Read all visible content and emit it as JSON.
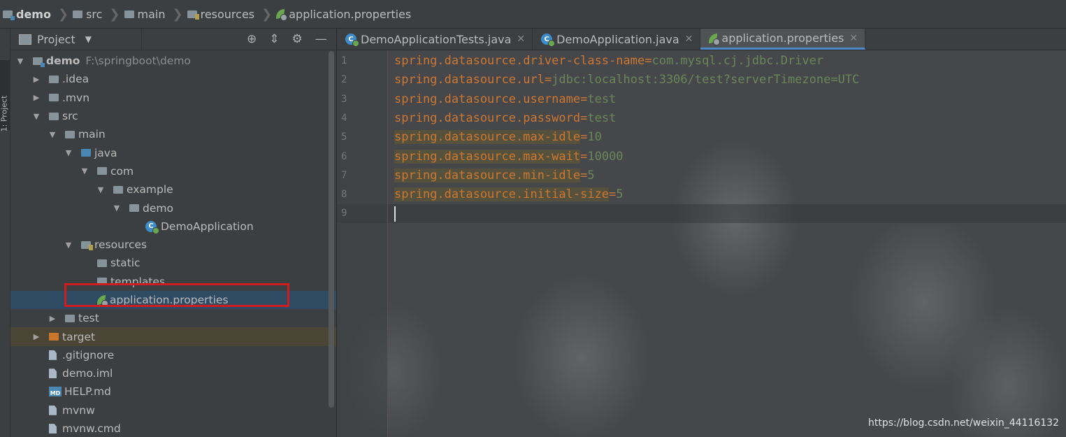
{
  "breadcrumb": {
    "items": [
      "demo",
      "src",
      "main",
      "resources",
      "application.properties"
    ]
  },
  "stripe": {
    "label": "1: Project"
  },
  "project_panel": {
    "title": "Project",
    "tools": [
      "locate-icon",
      "collapse-icon",
      "gear-icon",
      "minimize-icon"
    ],
    "tree": [
      {
        "label": "demo",
        "path": "F:\\springboot\\demo",
        "depth": 0,
        "arrow": "down",
        "icon": "module-folder-icon",
        "bold": true
      },
      {
        "label": ".idea",
        "depth": 1,
        "arrow": "right",
        "icon": "folder-icon"
      },
      {
        "label": ".mvn",
        "depth": 1,
        "arrow": "right",
        "icon": "folder-icon"
      },
      {
        "label": "src",
        "depth": 1,
        "arrow": "down",
        "icon": "folder-icon"
      },
      {
        "label": "main",
        "depth": 2,
        "arrow": "down",
        "icon": "folder-icon"
      },
      {
        "label": "java",
        "depth": 3,
        "arrow": "down",
        "icon": "source-folder-icon"
      },
      {
        "label": "com",
        "depth": 4,
        "arrow": "down",
        "icon": "package-icon"
      },
      {
        "label": "example",
        "depth": 5,
        "arrow": "down",
        "icon": "package-icon"
      },
      {
        "label": "demo",
        "depth": 6,
        "arrow": "down",
        "icon": "package-icon"
      },
      {
        "label": "DemoApplication",
        "depth": 7,
        "arrow": "",
        "icon": "spring-class-icon"
      },
      {
        "label": "resources",
        "depth": 3,
        "arrow": "down",
        "icon": "resources-folder-icon"
      },
      {
        "label": "static",
        "depth": 4,
        "arrow": "",
        "icon": "package-icon"
      },
      {
        "label": "templates",
        "depth": 4,
        "arrow": "",
        "icon": "package-icon"
      },
      {
        "label": "application.properties",
        "depth": 4,
        "arrow": "",
        "icon": "spring-properties-icon",
        "selected": true
      },
      {
        "label": "test",
        "depth": 2,
        "arrow": "right",
        "icon": "folder-icon"
      },
      {
        "label": "target",
        "depth": 1,
        "arrow": "right",
        "icon": "excluded-folder-icon",
        "target": true
      },
      {
        "label": ".gitignore",
        "depth": 1,
        "arrow": "",
        "icon": "file-icon"
      },
      {
        "label": "demo.iml",
        "depth": 1,
        "arrow": "",
        "icon": "file-icon"
      },
      {
        "label": "HELP.md",
        "depth": 1,
        "arrow": "",
        "icon": "markdown-icon"
      },
      {
        "label": "mvnw",
        "depth": 1,
        "arrow": "",
        "icon": "file-icon"
      },
      {
        "label": "mvnw.cmd",
        "depth": 1,
        "arrow": "",
        "icon": "file-icon"
      }
    ]
  },
  "editor": {
    "tabs": [
      {
        "label": "DemoApplicationTests.java",
        "icon": "class-icon",
        "active": false
      },
      {
        "label": "DemoApplication.java",
        "icon": "spring-class-icon",
        "active": false
      },
      {
        "label": "application.properties",
        "icon": "spring-properties-icon",
        "active": true
      }
    ],
    "lines": [
      {
        "num": "1",
        "key": "spring.datasource.driver-class-name",
        "eq": "=",
        "value": "com.mysql.cj.jdbc.Driver",
        "warn": false
      },
      {
        "num": "2",
        "key": "spring.datasource.url",
        "eq": "=",
        "value": "jdbc:localhost:3306/test?serverTimezone=UTC",
        "warn": false
      },
      {
        "num": "3",
        "key": "spring.datasource.username",
        "eq": "=",
        "value": "test",
        "warn": false
      },
      {
        "num": "4",
        "key": "spring.datasource.password",
        "eq": "=",
        "value": "test",
        "warn": false
      },
      {
        "num": "5",
        "key": "spring.datasource.max-idle",
        "eq": "=",
        "value": "10",
        "warn": true
      },
      {
        "num": "6",
        "key": "spring.datasource.max-wait",
        "eq": "=",
        "value": "10000",
        "warn": true
      },
      {
        "num": "7",
        "key": "spring.datasource.min-idle",
        "eq": "=",
        "value": "5",
        "warn": true
      },
      {
        "num": "8",
        "key": "spring.datasource.initial-size",
        "eq": "=",
        "value": "5",
        "warn": true
      },
      {
        "num": "9",
        "key": "",
        "eq": "",
        "value": "",
        "warn": false,
        "caret": true
      }
    ]
  },
  "watermark": "https://blog.csdn.net/weixin_44116132",
  "colors": {
    "key": "#cc7832",
    "value": "#6a8759",
    "selection": "#2f4a63",
    "highlight_box": "#d01c1c"
  }
}
